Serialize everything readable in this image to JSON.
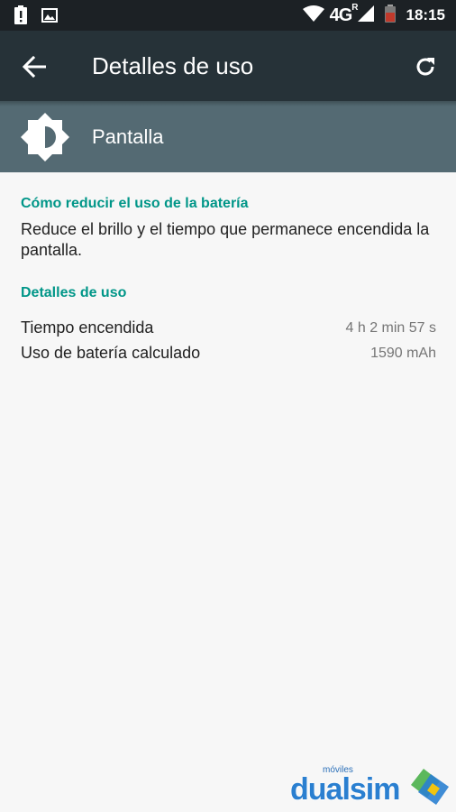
{
  "status_bar": {
    "network": "4G",
    "network_sup": "R",
    "time": "18:15",
    "icons": [
      "alert-icon",
      "image-icon",
      "wifi-icon",
      "signal-icon",
      "battery-icon"
    ],
    "battery_color": "#c0392b"
  },
  "toolbar": {
    "title": "Detalles de uso",
    "back_icon": "arrow-back-icon",
    "refresh_icon": "refresh-icon",
    "background": "#263238"
  },
  "app_header": {
    "name": "Pantalla",
    "icon": "brightness-icon",
    "background": "#546a73"
  },
  "sections": {
    "reduce": {
      "title": "Cómo reducir el uso de la batería",
      "description": "Reduce el brillo y el tiempo que permanece encendida la pantalla."
    },
    "details": {
      "title": "Detalles de uso",
      "rows": [
        {
          "label": "Tiempo encendida",
          "value": "4 h 2 min 57 s"
        },
        {
          "label": "Uso de batería calculado",
          "value": "1590 mAh"
        }
      ]
    }
  },
  "watermark": {
    "small": "móviles",
    "brand": "dualsim"
  },
  "colors": {
    "accent": "#009688",
    "text_primary": "#212121",
    "text_secondary": "#757575"
  }
}
